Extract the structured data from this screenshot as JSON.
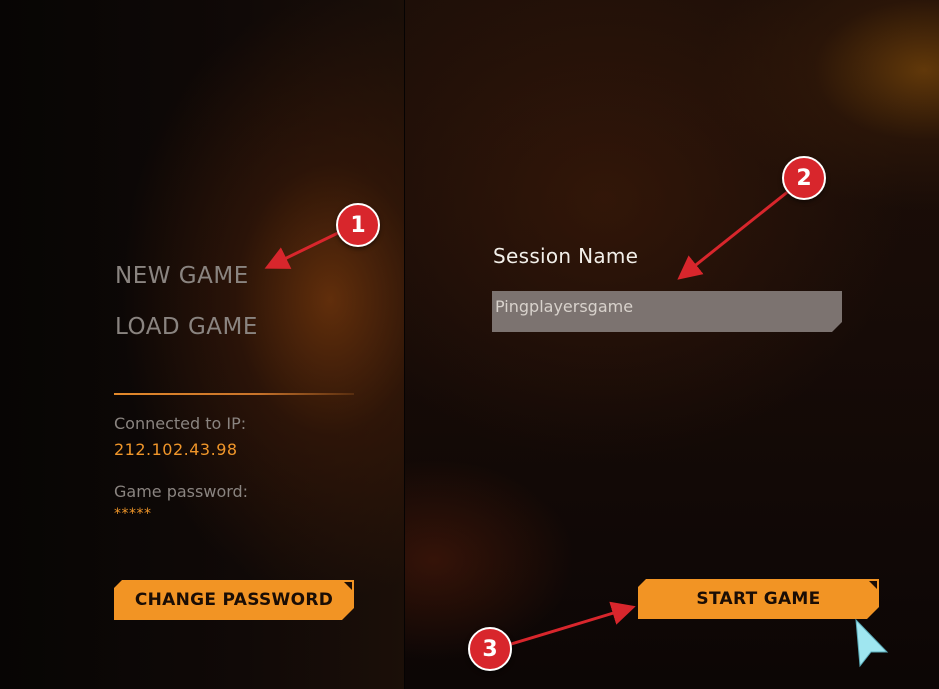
{
  "menu": {
    "new_game": "NEW GAME",
    "load_game": "LOAD GAME"
  },
  "connection": {
    "ip_label": "Connected to IP:",
    "ip_value": "212.102.43.98",
    "password_label": "Game password:",
    "password_value": "*****"
  },
  "buttons": {
    "change_password": "CHANGE PASSWORD",
    "start_game": "START GAME"
  },
  "session": {
    "label": "Session Name",
    "value": "Pingplayersgame"
  },
  "annotations": {
    "callout_1": "1",
    "callout_2": "2",
    "callout_3": "3"
  },
  "colors": {
    "accent_orange": "#f29424",
    "annotation_red": "#d8262c",
    "muted_text": "#8a8480",
    "cursor": "#9fe6f0"
  },
  "icons": {
    "cursor": "mouse-cursor-icon",
    "button_corner": "corner-notch-icon"
  }
}
